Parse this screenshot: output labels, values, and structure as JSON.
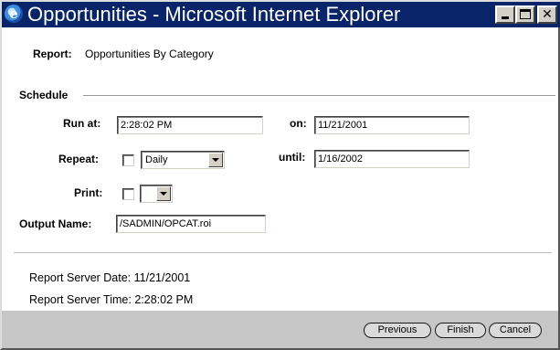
{
  "window": {
    "title": "Opportunities - Microsoft Internet Explorer"
  },
  "report": {
    "label": "Report:",
    "value": "Opportunities By Category"
  },
  "schedule": {
    "heading": "Schedule",
    "run_at_label": "Run at:",
    "run_at_value": "2:28:02 PM",
    "on_label": "on:",
    "on_value": "11/21/2001",
    "repeat_label": "Repeat:",
    "repeat_select": "Daily",
    "until_label": "until:",
    "until_value": "1/16/2002",
    "print_label": "Print:",
    "print_select": "",
    "output_name_label": "Output Name:",
    "output_name_value": "/SADMIN/OPCAT.roi"
  },
  "server": {
    "date": "Report Server Date: 11/21/2001",
    "time": "Report Server Time: 2:28:02 PM"
  },
  "buttons": {
    "previous": "Previous",
    "finish": "Finish",
    "cancel": "Cancel"
  }
}
